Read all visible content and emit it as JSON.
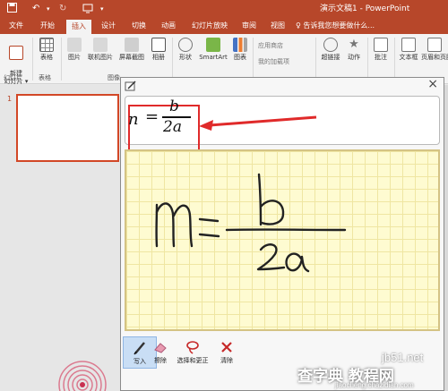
{
  "app": {
    "title": "演示文稿1 - PowerPoint",
    "qat": {
      "save_icon": "save-icon",
      "undo_icon": "undo-icon",
      "redo_icon": "redo-icon",
      "customize_icon": "customize-icon"
    }
  },
  "tabs": [
    {
      "label": "文件"
    },
    {
      "label": "开始"
    },
    {
      "label": "插入",
      "active": true
    },
    {
      "label": "设计"
    },
    {
      "label": "切换"
    },
    {
      "label": "动画"
    },
    {
      "label": "幻灯片放映"
    },
    {
      "label": "审阅"
    },
    {
      "label": "视图"
    }
  ],
  "tell_me": "♀ 告诉我您想要做什么...",
  "ribbon": {
    "new_slide": "新建\n幻灯片 ▾",
    "table": "表格",
    "pictures": "图片",
    "online_pictures": "联机图片",
    "screenshot": "屏幕截图",
    "album": "相册",
    "shapes": "形状",
    "smartart": "SmartArt",
    "chart": "图表",
    "store": "应用商店",
    "my_addins": "我的加载项",
    "hyperlink": "超链接",
    "action": "动作",
    "comment": "批注",
    "textbox": "文本框",
    "header_footer": "页眉和页脚",
    "groups": {
      "slides": "幻灯片",
      "tables": "表格",
      "images": "图像"
    }
  },
  "slides": {
    "number": "1"
  },
  "dialog": {
    "close_label": "×",
    "equation": {
      "lhs": "n",
      "equals": "=",
      "numerator": "b",
      "denominator": "2a"
    },
    "tools": [
      {
        "label": "写入",
        "icon": "pen-icon",
        "active": true
      },
      {
        "label": "擦除",
        "icon": "eraser-icon",
        "active": false
      },
      {
        "label": "选择和更正",
        "icon": "lasso-icon",
        "active": false
      },
      {
        "label": "清除",
        "icon": "clear-icon",
        "active": false
      }
    ]
  },
  "watermark": {
    "line1": "jb51.net",
    "line2": "查字典 教程网",
    "line3": "jiaocheng.chazidian.com"
  },
  "colors": {
    "accent": "#b7472a",
    "highlight": "#e02a2a",
    "ink": "#222222",
    "canvas": "#fefbd1"
  }
}
